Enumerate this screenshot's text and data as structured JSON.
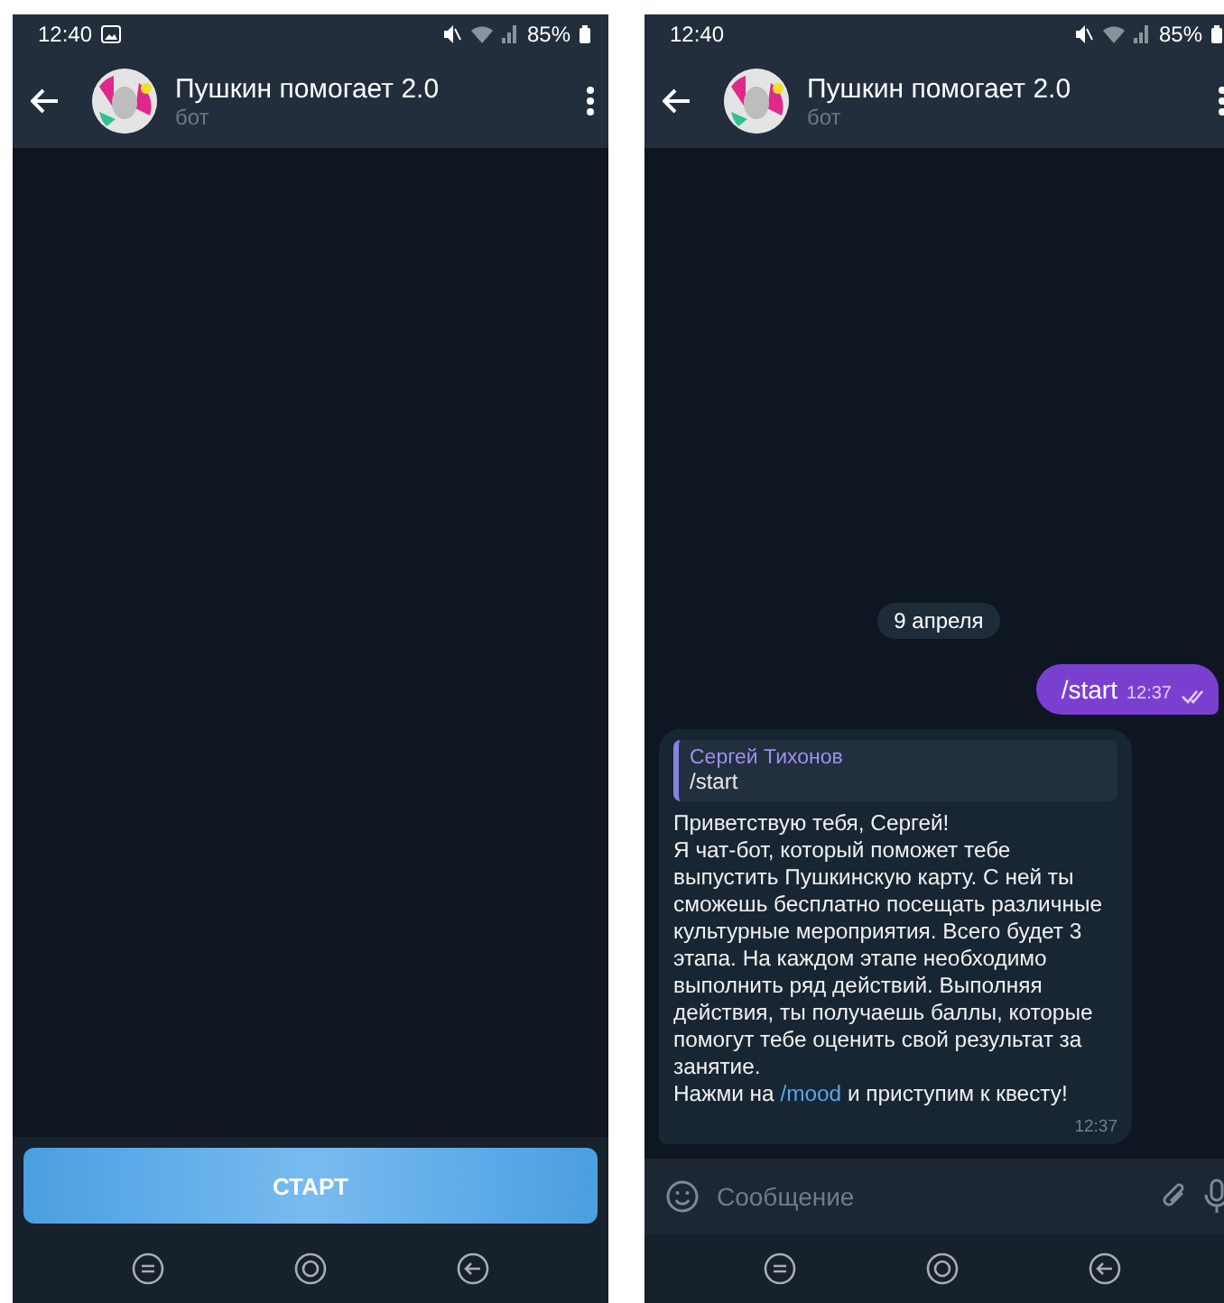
{
  "screens": [
    {
      "status_bar": {
        "time": "12:40",
        "notification_icon": true,
        "battery": "85%"
      },
      "header": {
        "title": "Пушкин помогает 2.0",
        "subtitle": "бот"
      },
      "bottom": {
        "kind": "start_button",
        "label": "СТАРТ"
      }
    },
    {
      "status_bar": {
        "time": "12:40",
        "notification_icon": false,
        "battery": "85%"
      },
      "header": {
        "title": "Пушкин помогает 2.0",
        "subtitle": "бот"
      },
      "date_chip": "9 апреля",
      "messages": [
        {
          "kind": "outgoing",
          "text": "/start",
          "time": "12:37",
          "read": true
        },
        {
          "kind": "incoming",
          "reply": {
            "author": "Сергей Тихонов",
            "text": "/start"
          },
          "paragraphs": [
            "Приветствую тебя, Сергей!",
            "Я чат-бот, который поможет тебе выпустить Пушкинскую карту. С ней ты сможешь бесплатно посещать различные культурные мероприятия. Всего будет 3 этапа. На каждом этапе необходимо выполнить ряд действий. Выполняя действия, ты получаешь баллы, которые помогут тебе оценить свой результат за занятие."
          ],
          "last_line": {
            "before": "Нажми на ",
            "command": "/mood",
            "after": " и приступим к квесту!"
          },
          "time": "12:37"
        }
      ],
      "bottom": {
        "kind": "composer",
        "placeholder": "Сообщение"
      }
    }
  ]
}
